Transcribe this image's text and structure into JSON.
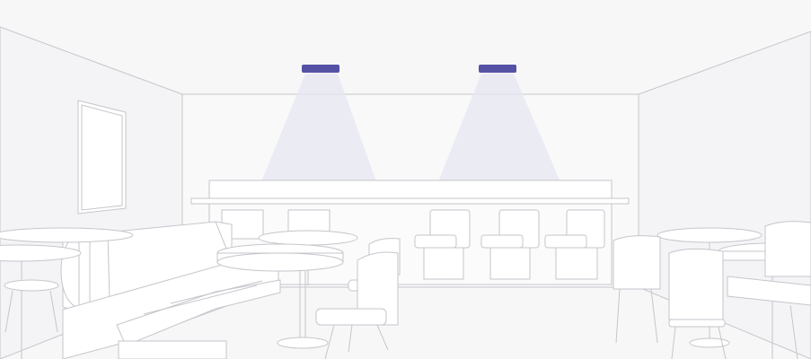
{
  "scene": {
    "alt": "",
    "colors": {
      "background": "#f7f7f8",
      "line": "#c6c6cc",
      "surface": "#ffffff",
      "lamp": "#5552a6",
      "light_beam": "#e6e5f2"
    },
    "elements": [
      "ceiling-lamp-left",
      "ceiling-lamp-right",
      "light-beam-left",
      "light-beam-right",
      "wall-frame",
      "bar-counter",
      "bar-stools",
      "booth-bench",
      "round-tables",
      "cafe-chairs"
    ]
  }
}
